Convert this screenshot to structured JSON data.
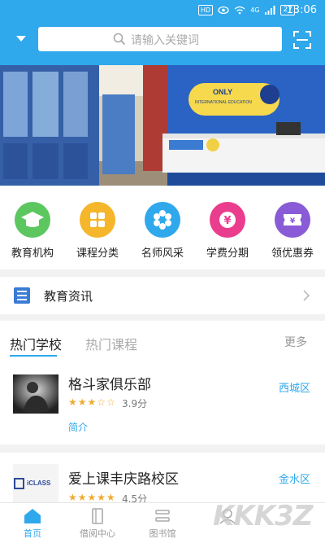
{
  "status_bar": {
    "time": "13:06",
    "hd": "HD",
    "network": "4G",
    "battery": "27"
  },
  "search": {
    "placeholder": "请输入关键词"
  },
  "banner": {
    "sign_line1": "ONLY",
    "sign_line2": "INTERNATIONAL EDUCATION"
  },
  "categories": [
    {
      "label": "教育机构",
      "icon": "graduation-cap-icon",
      "color": "#5cc75f"
    },
    {
      "label": "课程分类",
      "icon": "grid-icon",
      "color": "#f5b62b"
    },
    {
      "label": "名师风采",
      "icon": "flower-icon",
      "color": "#2fa8ec"
    },
    {
      "label": "学费分期",
      "icon": "yen-icon",
      "color": "#ea3d8e"
    },
    {
      "label": "领优惠券",
      "icon": "coupon-icon",
      "color": "#8a5bd6"
    }
  ],
  "news": {
    "label": "教育资讯"
  },
  "hot": {
    "tabs": [
      "热门学校",
      "热门课程"
    ],
    "more": "更多",
    "items": [
      {
        "name": "格斗家俱乐部",
        "rating": 3.5,
        "score": "3.9分",
        "intro": "简介",
        "area": "西城区"
      },
      {
        "name": "爱上课丰庆路校区",
        "rating": 4.5,
        "score": "4.5分",
        "intro": "",
        "area": "金水区"
      }
    ]
  },
  "nav": [
    {
      "label": "首页",
      "icon": "home-icon",
      "active": true
    },
    {
      "label": "借阅中心",
      "icon": "book-icon",
      "active": false
    },
    {
      "label": "图书馆",
      "icon": "library-icon",
      "active": false
    },
    {
      "label": "",
      "icon": "profile-icon",
      "active": false
    }
  ],
  "watermark": "KKK3Z",
  "thumb2_logo": "iCLASS",
  "colors": {
    "primary": "#2fa8ec",
    "star": "#f0ab2e"
  }
}
